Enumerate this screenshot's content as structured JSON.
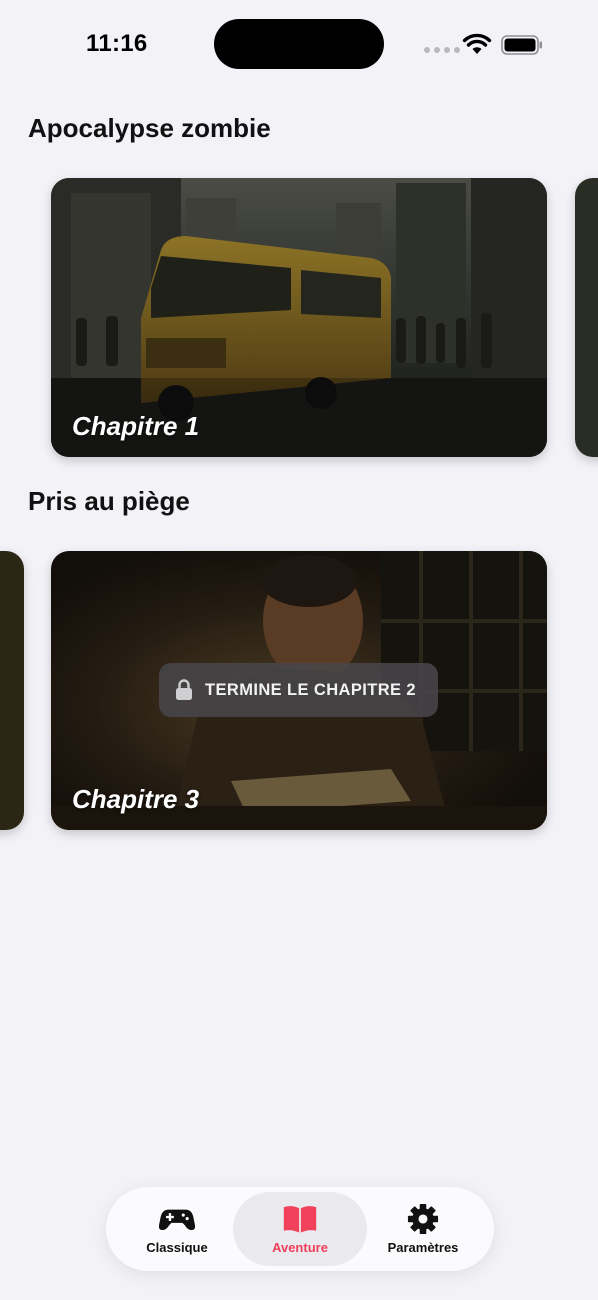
{
  "status_bar": {
    "time": "11:16"
  },
  "sections": [
    {
      "title": "Apocalypse zombie",
      "cards": [
        {
          "title": "Chapitre 1",
          "locked": false
        }
      ]
    },
    {
      "title": "Pris au piège",
      "cards": [
        {
          "title": "Chapitre 3",
          "locked": true,
          "lock_text": "TERMINE LE CHAPITRE 2"
        }
      ]
    }
  ],
  "tab_bar": {
    "tabs": [
      {
        "label": "Classique",
        "icon": "gamepad-icon"
      },
      {
        "label": "Aventure",
        "icon": "book-icon",
        "active": true
      },
      {
        "label": "Paramètres",
        "icon": "gear-icon"
      }
    ]
  },
  "colors": {
    "accent": "#f0405a",
    "background": "#f2f2f7"
  }
}
